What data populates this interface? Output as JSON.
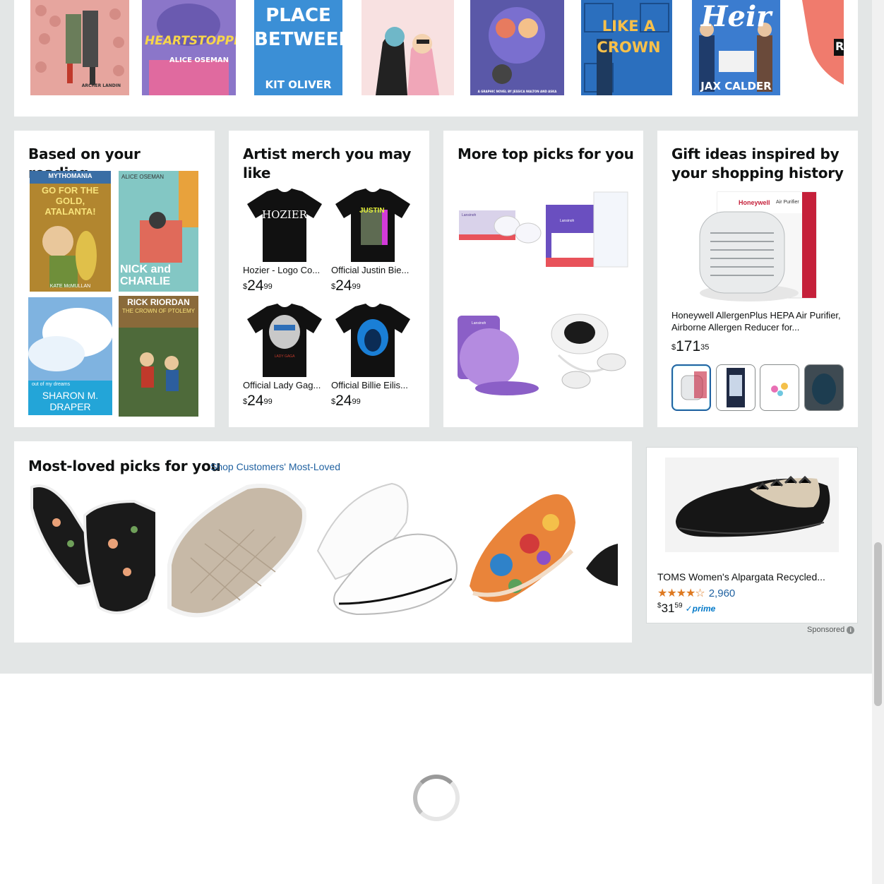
{
  "top_carousel": {
    "books": [
      {
        "cover_text": "ARCHER LANDIN",
        "bg": "#e8a8a0"
      },
      {
        "cover_text": "HEARTSTOPPER",
        "subtitle": "ALICE OSEMAN",
        "bg": "#8b76c9"
      },
      {
        "cover_text": "PLACE BETWEEN",
        "subtitle": "KIT OLIVER",
        "bg": "#3b8fd6"
      },
      {
        "cover_text": "",
        "bg": "#f7d6d6"
      },
      {
        "cover_text": "",
        "subtitle": "A GRAPHIC NOVEL BY JESSICA WALTON AND ASKA",
        "bg": "#6a5fb0"
      },
      {
        "cover_text": "LIKE A CROWN",
        "bg": "#2a6ebf"
      },
      {
        "cover_text": "Heir",
        "subtitle": "JAX CALDER",
        "bg": "#3a7bcf"
      },
      {
        "cover_text": "R",
        "bg": "#f4a9a0"
      }
    ]
  },
  "reading_card": {
    "title": "Based on your reading",
    "books": [
      {
        "cover_text": "GO FOR THE GOLD, ATALANTA!",
        "author": "KATE McMULLAN",
        "series": "MYTHOMANIA"
      },
      {
        "cover_text": "NICK and CHARLIE",
        "author": "ALICE OSEMAN"
      },
      {
        "cover_text": "out of my dreams",
        "author": "SHARON M. DRAPER"
      },
      {
        "cover_text": "THE CROWN OF PTOLEMY",
        "author": "RICK RIORDAN"
      }
    ]
  },
  "merch_card": {
    "title": "Artist merch you may like",
    "items": [
      {
        "title": "Hozier - Logo Co...",
        "price_whole": "24",
        "price_frac": "99",
        "print": "HOZIER"
      },
      {
        "title": "Official Justin Bie...",
        "price_whole": "24",
        "price_frac": "99",
        "print": "JUSTIN"
      },
      {
        "title": "Official Lady Gag...",
        "price_whole": "24",
        "price_frac": "99",
        "print": "LADY GAGA"
      },
      {
        "title": "Official Billie Eilis...",
        "price_whole": "24",
        "price_frac": "99",
        "print": ""
      }
    ],
    "currency": "$"
  },
  "picks_card": {
    "title": "More top picks for you",
    "items": [
      {
        "label": "Lansinoh"
      },
      {
        "label": "Lansinoh"
      },
      {
        "label": "Lansinoh"
      },
      {
        "label": ""
      }
    ]
  },
  "gift_card": {
    "title": "Gift ideas inspired by your shopping history",
    "product_title": "Honeywell AllergenPlus HEPA Air Purifier, Airborne Allergen Reducer for...",
    "product_box_brand": "Honeywell",
    "product_box_label": "Air Purifier",
    "currency": "$",
    "price_whole": "171",
    "price_frac": "35"
  },
  "loved_card": {
    "title": "Most-loved picks for you",
    "link": "Shop Customers' Most-Loved"
  },
  "sponsored": {
    "title": "TOMS Women's Alpargata Recycled...",
    "stars": "★★★★☆",
    "rating_count": "2,960",
    "currency": "$",
    "price_whole": "31",
    "price_frac": "59",
    "prime": "prime",
    "label": "Sponsored",
    "info_icon": "i"
  },
  "colors": {
    "link": "#2162a1",
    "star": "#de7921",
    "background": "#e3e6e6"
  }
}
